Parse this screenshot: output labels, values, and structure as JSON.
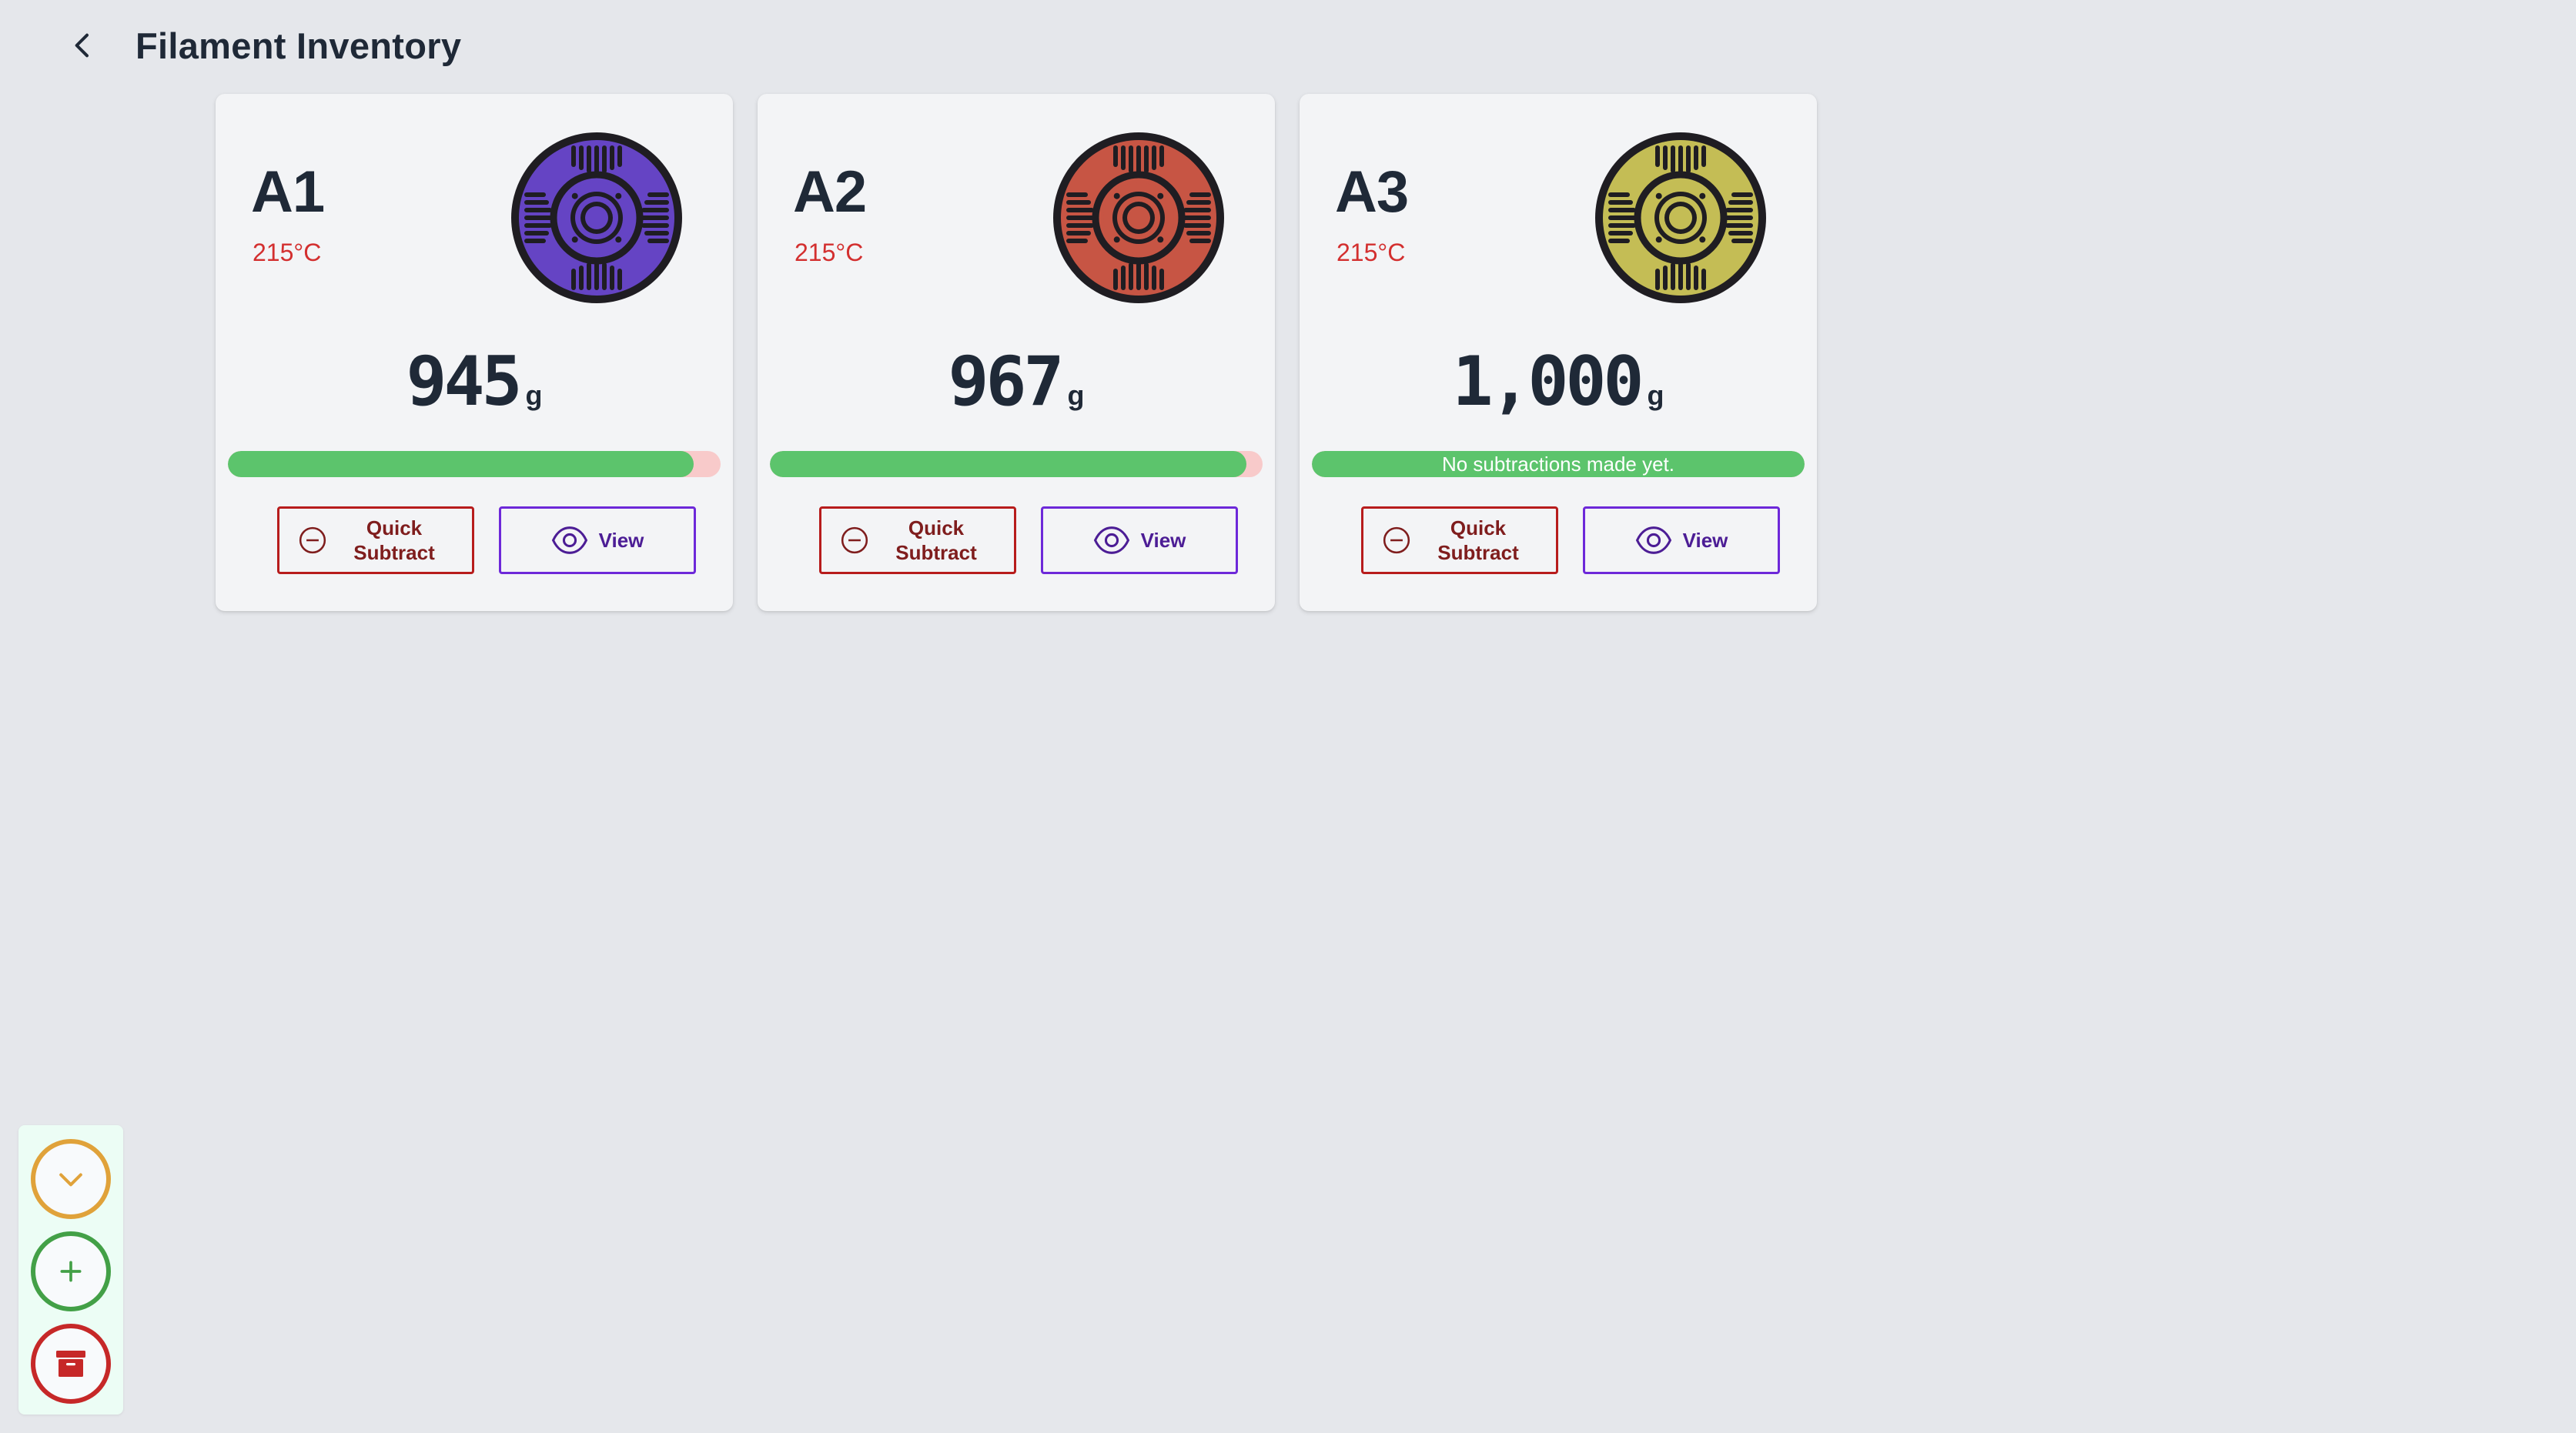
{
  "header": {
    "title": "Filament Inventory",
    "back_icon": "chevron-left-icon"
  },
  "spools": [
    {
      "name": "A1",
      "temp": "215°C",
      "color": "#6544c4",
      "weight": "945",
      "unit": "g",
      "remaining_fraction": 0.945,
      "progress_label": "",
      "quick_subtract_label_1": "Quick",
      "quick_subtract_label_2": "Subtract",
      "view_label": "View"
    },
    {
      "name": "A2",
      "temp": "215°C",
      "color": "#c75544",
      "weight": "967",
      "unit": "g",
      "remaining_fraction": 0.967,
      "progress_label": "",
      "quick_subtract_label_1": "Quick",
      "quick_subtract_label_2": "Subtract",
      "view_label": "View"
    },
    {
      "name": "A3",
      "temp": "215°C",
      "color": "#c4bd55",
      "weight": "1,000",
      "unit": "g",
      "remaining_fraction": 1.0,
      "progress_label": "No subtractions made yet.",
      "quick_subtract_label_1": "Quick",
      "quick_subtract_label_2": "Subtract",
      "view_label": "View"
    }
  ],
  "fab": {
    "collapse_icon": "chevron-down-icon",
    "add_icon": "plus-icon",
    "archive_icon": "archive-icon",
    "colors": {
      "collapse": "#e0a23a",
      "add": "#43a047",
      "archive": "#c62828"
    }
  },
  "colors": {
    "progress_fill": "#5cc46c",
    "progress_empty": "#f8caca",
    "temp_text": "#d32f2f",
    "subtract_border": "#b71c1c",
    "view_border": "#6d28d9"
  }
}
